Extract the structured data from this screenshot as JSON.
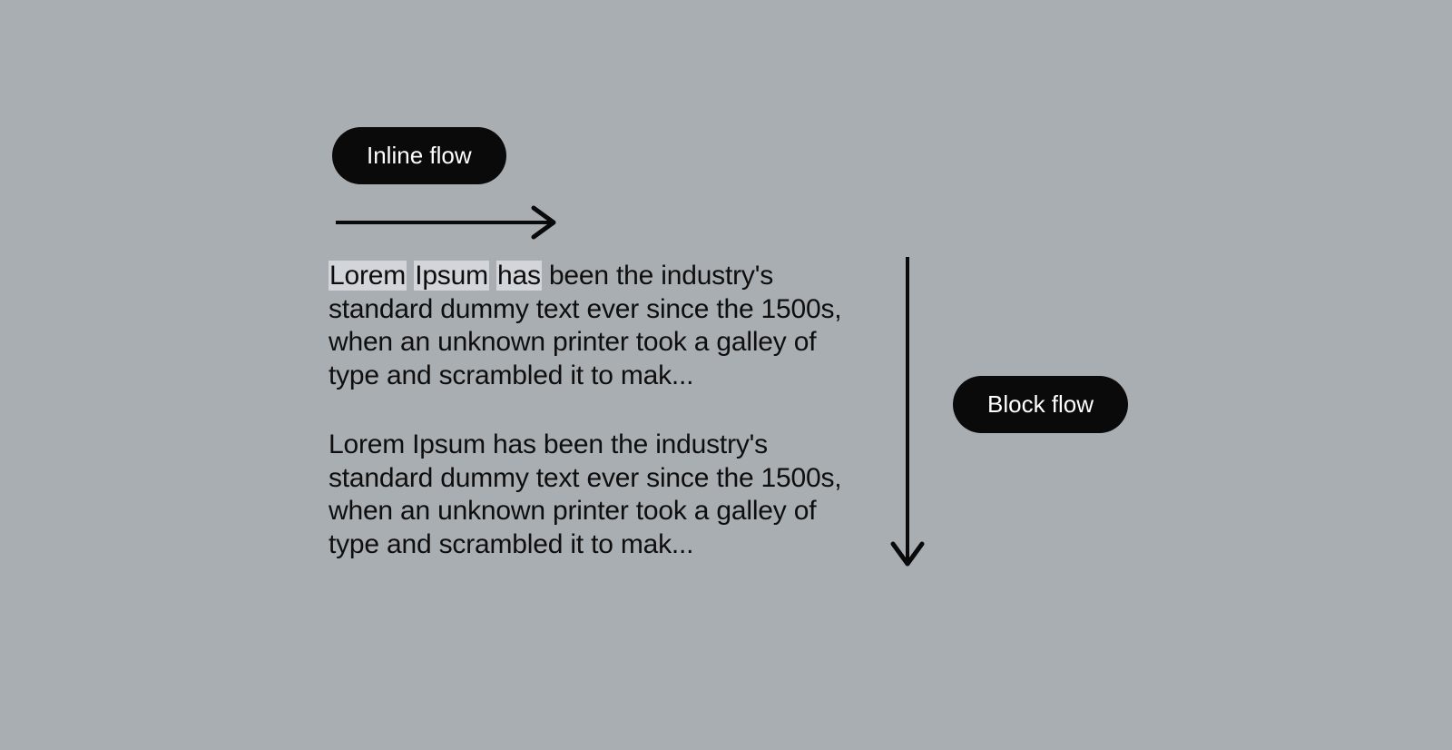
{
  "labels": {
    "inline": "Inline flow",
    "block": "Block flow"
  },
  "highlighted_words": [
    "Lorem",
    "Ipsum",
    "has"
  ],
  "paragraph1_tail": " been the industry's standard dummy text ever since the 1500s, when an unknown printer took a galley of type and scrambled it to mak...",
  "paragraph2": "Lorem Ipsum has been the industry's standard dummy text ever since the 1500s, when an unknown printer took a galley of type and scrambled it to mak...",
  "colors": {
    "background": "#a9aeb3",
    "pill_bg": "#0a0a0a",
    "pill_text": "#ffffff",
    "highlight": "#d2d5d9",
    "text": "#0e0e0e"
  }
}
